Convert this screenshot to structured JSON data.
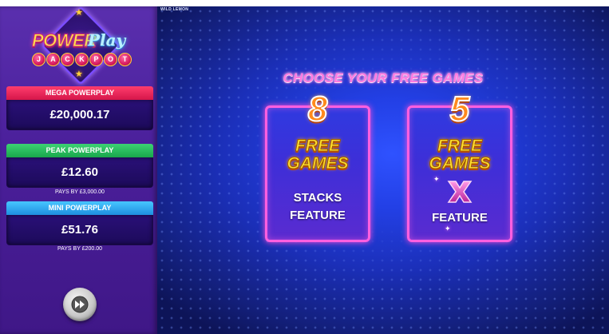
{
  "logo": {
    "power_text": "POWER",
    "play_text": "Play",
    "jackpot_letters": [
      "J",
      "A",
      "C",
      "K",
      "P",
      "O",
      "T"
    ]
  },
  "jackpots": {
    "mega": {
      "label": "MEGA POWERPLAY",
      "value": "£20,000.17",
      "color": "#e0194f"
    },
    "peak": {
      "label": "PEAK POWERPLAY",
      "value": "£12.60",
      "caption": "PAYS BY £3,000.00",
      "color": "#22b14c"
    },
    "mini": {
      "label": "MINI POWERPLAY",
      "value": "£51.76",
      "caption": "PAYS BY £200.00",
      "color": "#2a9df4"
    }
  },
  "buttons": {
    "spin_icon": "fast-forward-icon"
  },
  "game": {
    "studio_logo": "WILD LEMON",
    "title": "CHOOSE YOUR FREE GAMES",
    "options": [
      {
        "count": "8",
        "free": "FREE",
        "games": "GAMES",
        "feature_line1": "STACKS",
        "feature_line2": "FEATURE"
      },
      {
        "count": "5",
        "free": "FREE",
        "games": "GAMES",
        "feature_symbol": "x-multiplier-icon",
        "feature_line2": "FEATURE"
      }
    ]
  },
  "colors": {
    "panel_bg": "#4a1f9a",
    "game_bg": "#2340e6",
    "card_border": "#ff5fe0",
    "title_pink": "#ff7ae0"
  }
}
